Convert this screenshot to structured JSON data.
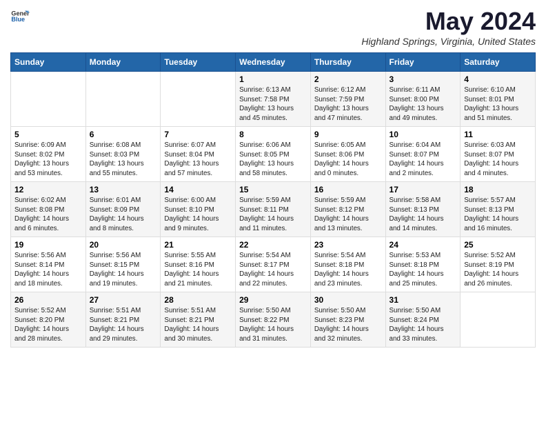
{
  "logo": {
    "line1": "General",
    "line2": "Blue"
  },
  "title": "May 2024",
  "subtitle": "Highland Springs, Virginia, United States",
  "days_of_week": [
    "Sunday",
    "Monday",
    "Tuesday",
    "Wednesday",
    "Thursday",
    "Friday",
    "Saturday"
  ],
  "weeks": [
    [
      {
        "day": "",
        "info": ""
      },
      {
        "day": "",
        "info": ""
      },
      {
        "day": "",
        "info": ""
      },
      {
        "day": "1",
        "info": "Sunrise: 6:13 AM\nSunset: 7:58 PM\nDaylight: 13 hours\nand 45 minutes."
      },
      {
        "day": "2",
        "info": "Sunrise: 6:12 AM\nSunset: 7:59 PM\nDaylight: 13 hours\nand 47 minutes."
      },
      {
        "day": "3",
        "info": "Sunrise: 6:11 AM\nSunset: 8:00 PM\nDaylight: 13 hours\nand 49 minutes."
      },
      {
        "day": "4",
        "info": "Sunrise: 6:10 AM\nSunset: 8:01 PM\nDaylight: 13 hours\nand 51 minutes."
      }
    ],
    [
      {
        "day": "5",
        "info": "Sunrise: 6:09 AM\nSunset: 8:02 PM\nDaylight: 13 hours\nand 53 minutes."
      },
      {
        "day": "6",
        "info": "Sunrise: 6:08 AM\nSunset: 8:03 PM\nDaylight: 13 hours\nand 55 minutes."
      },
      {
        "day": "7",
        "info": "Sunrise: 6:07 AM\nSunset: 8:04 PM\nDaylight: 13 hours\nand 57 minutes."
      },
      {
        "day": "8",
        "info": "Sunrise: 6:06 AM\nSunset: 8:05 PM\nDaylight: 13 hours\nand 58 minutes."
      },
      {
        "day": "9",
        "info": "Sunrise: 6:05 AM\nSunset: 8:06 PM\nDaylight: 14 hours\nand 0 minutes."
      },
      {
        "day": "10",
        "info": "Sunrise: 6:04 AM\nSunset: 8:07 PM\nDaylight: 14 hours\nand 2 minutes."
      },
      {
        "day": "11",
        "info": "Sunrise: 6:03 AM\nSunset: 8:07 PM\nDaylight: 14 hours\nand 4 minutes."
      }
    ],
    [
      {
        "day": "12",
        "info": "Sunrise: 6:02 AM\nSunset: 8:08 PM\nDaylight: 14 hours\nand 6 minutes."
      },
      {
        "day": "13",
        "info": "Sunrise: 6:01 AM\nSunset: 8:09 PM\nDaylight: 14 hours\nand 8 minutes."
      },
      {
        "day": "14",
        "info": "Sunrise: 6:00 AM\nSunset: 8:10 PM\nDaylight: 14 hours\nand 9 minutes."
      },
      {
        "day": "15",
        "info": "Sunrise: 5:59 AM\nSunset: 8:11 PM\nDaylight: 14 hours\nand 11 minutes."
      },
      {
        "day": "16",
        "info": "Sunrise: 5:59 AM\nSunset: 8:12 PM\nDaylight: 14 hours\nand 13 minutes."
      },
      {
        "day": "17",
        "info": "Sunrise: 5:58 AM\nSunset: 8:13 PM\nDaylight: 14 hours\nand 14 minutes."
      },
      {
        "day": "18",
        "info": "Sunrise: 5:57 AM\nSunset: 8:13 PM\nDaylight: 14 hours\nand 16 minutes."
      }
    ],
    [
      {
        "day": "19",
        "info": "Sunrise: 5:56 AM\nSunset: 8:14 PM\nDaylight: 14 hours\nand 18 minutes."
      },
      {
        "day": "20",
        "info": "Sunrise: 5:56 AM\nSunset: 8:15 PM\nDaylight: 14 hours\nand 19 minutes."
      },
      {
        "day": "21",
        "info": "Sunrise: 5:55 AM\nSunset: 8:16 PM\nDaylight: 14 hours\nand 21 minutes."
      },
      {
        "day": "22",
        "info": "Sunrise: 5:54 AM\nSunset: 8:17 PM\nDaylight: 14 hours\nand 22 minutes."
      },
      {
        "day": "23",
        "info": "Sunrise: 5:54 AM\nSunset: 8:18 PM\nDaylight: 14 hours\nand 23 minutes."
      },
      {
        "day": "24",
        "info": "Sunrise: 5:53 AM\nSunset: 8:18 PM\nDaylight: 14 hours\nand 25 minutes."
      },
      {
        "day": "25",
        "info": "Sunrise: 5:52 AM\nSunset: 8:19 PM\nDaylight: 14 hours\nand 26 minutes."
      }
    ],
    [
      {
        "day": "26",
        "info": "Sunrise: 5:52 AM\nSunset: 8:20 PM\nDaylight: 14 hours\nand 28 minutes."
      },
      {
        "day": "27",
        "info": "Sunrise: 5:51 AM\nSunset: 8:21 PM\nDaylight: 14 hours\nand 29 minutes."
      },
      {
        "day": "28",
        "info": "Sunrise: 5:51 AM\nSunset: 8:21 PM\nDaylight: 14 hours\nand 30 minutes."
      },
      {
        "day": "29",
        "info": "Sunrise: 5:50 AM\nSunset: 8:22 PM\nDaylight: 14 hours\nand 31 minutes."
      },
      {
        "day": "30",
        "info": "Sunrise: 5:50 AM\nSunset: 8:23 PM\nDaylight: 14 hours\nand 32 minutes."
      },
      {
        "day": "31",
        "info": "Sunrise: 5:50 AM\nSunset: 8:24 PM\nDaylight: 14 hours\nand 33 minutes."
      },
      {
        "day": "",
        "info": ""
      }
    ]
  ]
}
